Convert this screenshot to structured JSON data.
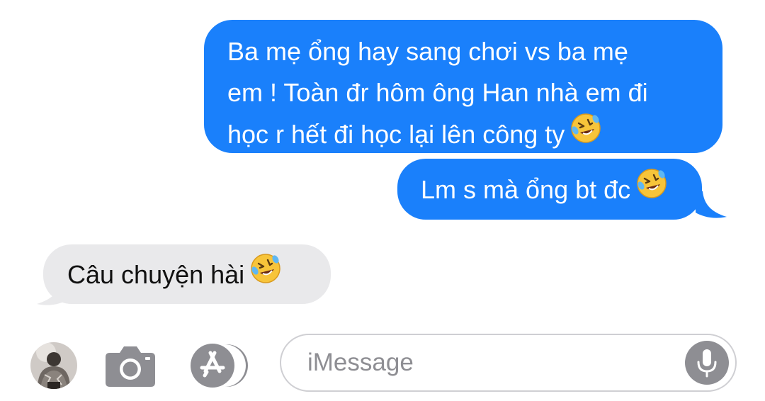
{
  "conversation": {
    "messages": [
      {
        "direction": "sent",
        "lines": [
          "Ba mẹ ổng hay sang chơi vs ba mẹ",
          "em ! Toàn đr hôm ông Han nhà em đi",
          "học r hết đi học lại lên công ty"
        ],
        "emoji": "rolling-on-the-floor-laughing"
      },
      {
        "direction": "sent",
        "lines": [
          "Lm s mà ổng bt đc"
        ],
        "emoji": "rolling-on-the-floor-laughing"
      },
      {
        "direction": "received",
        "lines": [
          "Câu chuyện hài"
        ],
        "emoji": "rolling-on-the-floor-laughing"
      }
    ]
  },
  "input_bar": {
    "avatar_icon": "contact-photo",
    "camera_icon": "camera-icon",
    "apps_icon": "app-store-icon",
    "message_field": {
      "placeholder": "iMessage",
      "value": ""
    },
    "mic_icon": "microphone-icon"
  },
  "colors": {
    "sent_bubble": "#1a80fb",
    "received_bubble": "#e9e9eb",
    "icon_gray": "#8e8e93",
    "field_border": "#cfcfd3"
  }
}
